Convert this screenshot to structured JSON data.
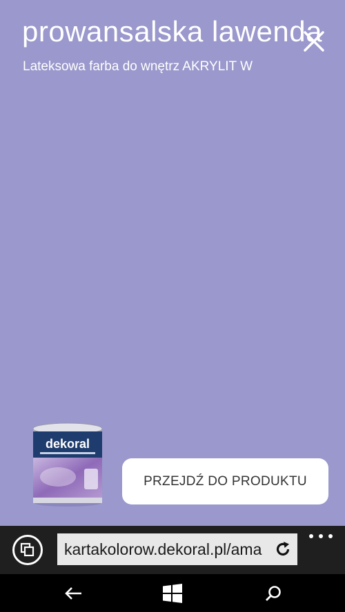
{
  "color_card": {
    "color_name": "prowansalska lawenda",
    "product_line": "Lateksowa farba do wnętrz AKRYLIT W",
    "swatch_color": "#9a98cc",
    "close_icon": "close-icon"
  },
  "product": {
    "brand": "dekoral",
    "button_label": "PRZEJDŹ DO PRODUKTU"
  },
  "browser": {
    "url": "kartakolorow.dekoral.pl/ama",
    "tabs_icon": "tabs-icon",
    "refresh_icon": "refresh-icon",
    "more_icon": "more-icon"
  },
  "navigation": {
    "back_icon": "back-arrow-icon",
    "home_icon": "windows-logo-icon",
    "search_icon": "search-icon"
  }
}
